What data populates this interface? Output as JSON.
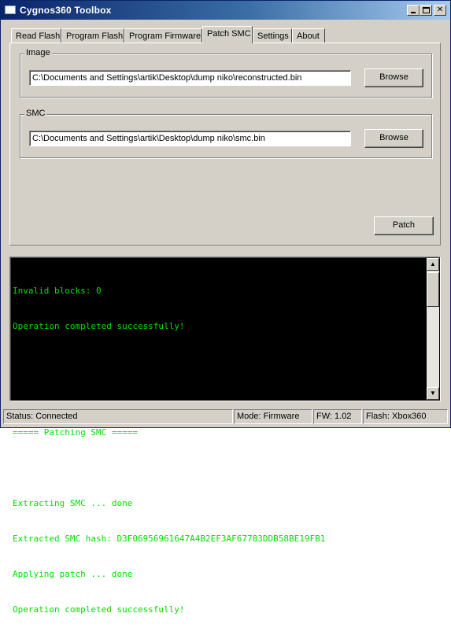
{
  "window": {
    "title": "Cygnos360 Toolbox"
  },
  "tabs": [
    {
      "label": "Read Flash",
      "active": false
    },
    {
      "label": "Program Flash",
      "active": false
    },
    {
      "label": "Program Firmware",
      "active": false
    },
    {
      "label": "Patch SMC",
      "active": true
    },
    {
      "label": "Settings",
      "active": false
    },
    {
      "label": "About",
      "active": false
    }
  ],
  "image_group": {
    "label": "Image",
    "path": "C:\\Documents and Settings\\artik\\Desktop\\dump niko\\reconstructed.bin",
    "browse_label": "Browse"
  },
  "smc_group": {
    "label": "SMC",
    "path": "C:\\Documents and Settings\\artik\\Desktop\\dump niko\\smc.bin",
    "browse_label": "Browse"
  },
  "patch_label": "Patch",
  "console": {
    "lines": [
      "Invalid blocks: 0",
      "Operation completed successfully!",
      "",
      "",
      "===== Patching SMC =====",
      "",
      "Extracting SMC ... done",
      "Extracted SMC hash: D3F06956961647A4B2EF3AF67783DDB58BE19FB1",
      "Applying patch ... done",
      "Operation completed successfully!"
    ]
  },
  "status": {
    "status": "Status: Connected",
    "mode": "Mode: Firmware",
    "fw": "FW: 1.02",
    "flash": "Flash: Xbox360"
  },
  "colors": {
    "console_text": "#00e000",
    "console_bg": "#000000",
    "title_bar": "#0a246a",
    "dialog_bg": "#d4d0c8"
  },
  "icons": {
    "app": "window-icon",
    "minimize": "minimize-icon",
    "maximize": "maximize-icon",
    "close": "close-icon"
  }
}
